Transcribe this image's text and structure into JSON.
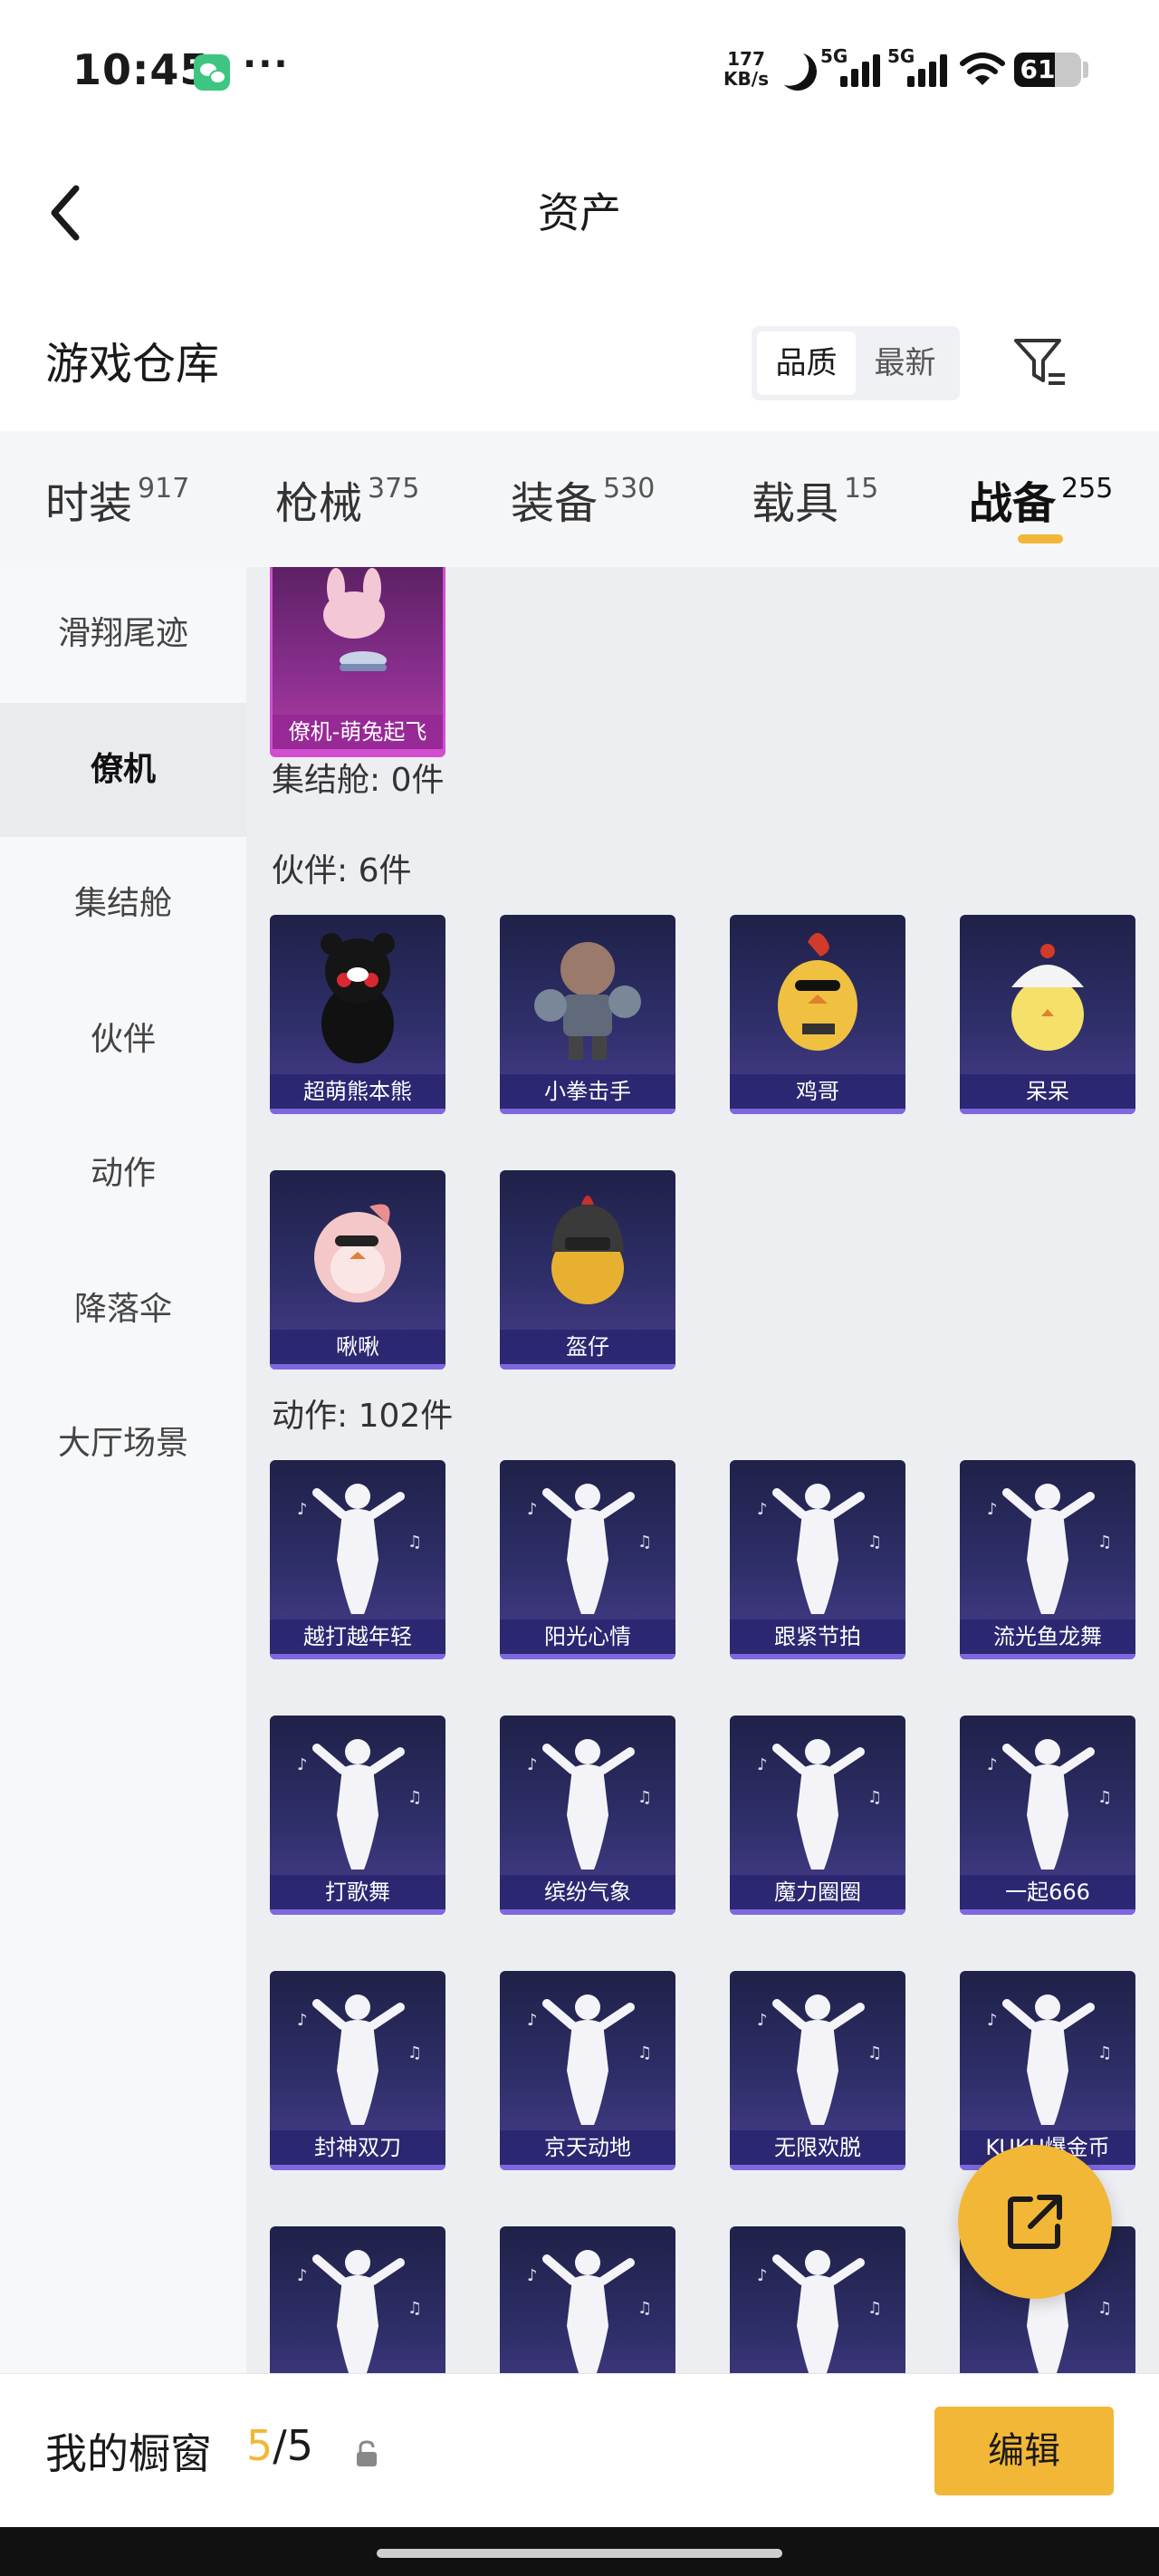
{
  "status_bar": {
    "time": "10:45",
    "net_speed_value": "177",
    "net_speed_unit": "KB/s",
    "signal_1_label": "5G",
    "signal_2_label": "5G",
    "battery_level": "61"
  },
  "header": {
    "title": "资产",
    "back_icon": "chevron-left-icon"
  },
  "warehouse": {
    "title": "游戏仓库",
    "sort_options": [
      "品质",
      "最新"
    ],
    "active_sort": "品质",
    "filter_icon": "filter-icon"
  },
  "tabs": [
    {
      "label": "时装",
      "count": "917",
      "active": false
    },
    {
      "label": "枪械",
      "count": "375",
      "active": false
    },
    {
      "label": "装备",
      "count": "530",
      "active": false
    },
    {
      "label": "载具",
      "count": "15",
      "active": false
    },
    {
      "label": "战备",
      "count": "255",
      "active": true
    }
  ],
  "sidebar": {
    "items": [
      {
        "label": "滑翔尾迹",
        "active": false
      },
      {
        "label": "僚机",
        "active": true
      },
      {
        "label": "集结舱",
        "active": false
      },
      {
        "label": "伙伴",
        "active": false
      },
      {
        "label": "动作",
        "active": false
      },
      {
        "label": "降落伞",
        "active": false
      },
      {
        "label": "大厅场景",
        "active": false
      }
    ]
  },
  "content": {
    "top_card": {
      "name": "僚机-萌兔起飞"
    },
    "groups": [
      {
        "label": "集结舱: 0件",
        "items": []
      },
      {
        "label": "伙伴: 6件",
        "items": [
          "超萌熊本熊",
          "小拳击手",
          "鸡哥",
          "呆呆",
          "啾啾",
          "盔仔"
        ]
      },
      {
        "label": "动作: 102件",
        "items": [
          "越打越年轻",
          "阳光心情",
          "跟紧节拍",
          "流光鱼龙舞",
          "打歌舞",
          "缤纷气象",
          "魔力圈圈",
          "一起666",
          "封神双刀",
          "京天动地",
          "无限欢脱",
          "KUKU爆金币",
          "",
          "",
          "",
          ""
        ]
      }
    ]
  },
  "fab": {
    "icon": "share-external-icon"
  },
  "bottom_bar": {
    "label": "我的橱窗",
    "current": "5",
    "separator": "/",
    "total": "5",
    "lock_icon": "lock-icon",
    "edit_label": "编辑"
  },
  "colors": {
    "accent": "#f2b736",
    "card_dark": "#2f2f6a",
    "card_purple": "#8a2f8f"
  }
}
